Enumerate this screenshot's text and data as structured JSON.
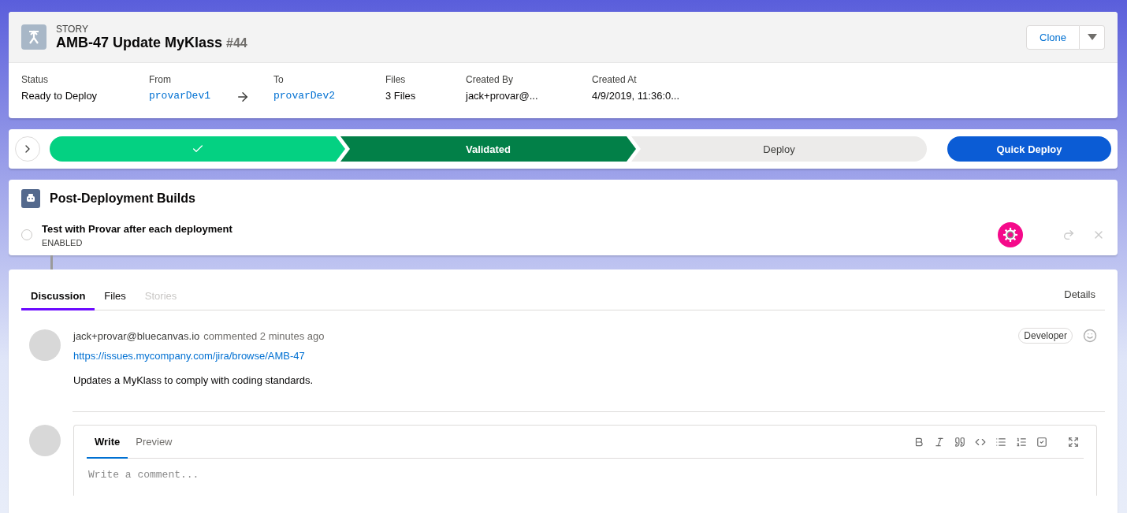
{
  "record": {
    "type_label": "STORY",
    "title": "AMB-47 Update MyKlass",
    "number": "#44",
    "actions": {
      "clone": "Clone"
    }
  },
  "fields": [
    {
      "label": "Status",
      "value": "Ready to Deploy",
      "kind": "text"
    },
    {
      "label": "From",
      "value": "provarDev1",
      "kind": "branch"
    },
    {
      "label": "To",
      "value": "provarDev2",
      "kind": "branch"
    },
    {
      "label": "Files",
      "value": "3 Files",
      "kind": "text"
    },
    {
      "label": "Created By",
      "value": "jack+provar@...",
      "kind": "text"
    },
    {
      "label": "Created At",
      "value": "4/9/2019, 11:36:0...",
      "kind": "text"
    }
  ],
  "path": {
    "stages": [
      {
        "complete": true,
        "selected": false
      },
      {
        "label": "Validated",
        "complete": true,
        "selected": true
      },
      {
        "label": "Deploy",
        "complete": false,
        "selected": false
      }
    ],
    "action": "Quick Deploy"
  },
  "builds": {
    "title": "Post-Deployment Builds",
    "items": [
      {
        "name": "Test with Provar after each deployment",
        "state": "ENABLED",
        "checked": false
      }
    ]
  },
  "tabs": [
    {
      "label": "Discussion",
      "selected": true,
      "disabled": false
    },
    {
      "label": "Files",
      "selected": false,
      "disabled": false
    },
    {
      "label": "Stories",
      "selected": false,
      "disabled": true
    }
  ],
  "details_link": "Details",
  "comment": {
    "author": "jack+provar@bluecanvas.io",
    "action": "commented 2 minutes ago",
    "badge": "Developer",
    "link": "https://issues.mycompany.com/jira/browse/AMB-47",
    "body": "Updates a MyKlass to comply with coding standards."
  },
  "editor": {
    "tabs": [
      {
        "label": "Write",
        "selected": true
      },
      {
        "label": "Preview",
        "selected": false
      }
    ],
    "placeholder": "Write a comment..."
  }
}
